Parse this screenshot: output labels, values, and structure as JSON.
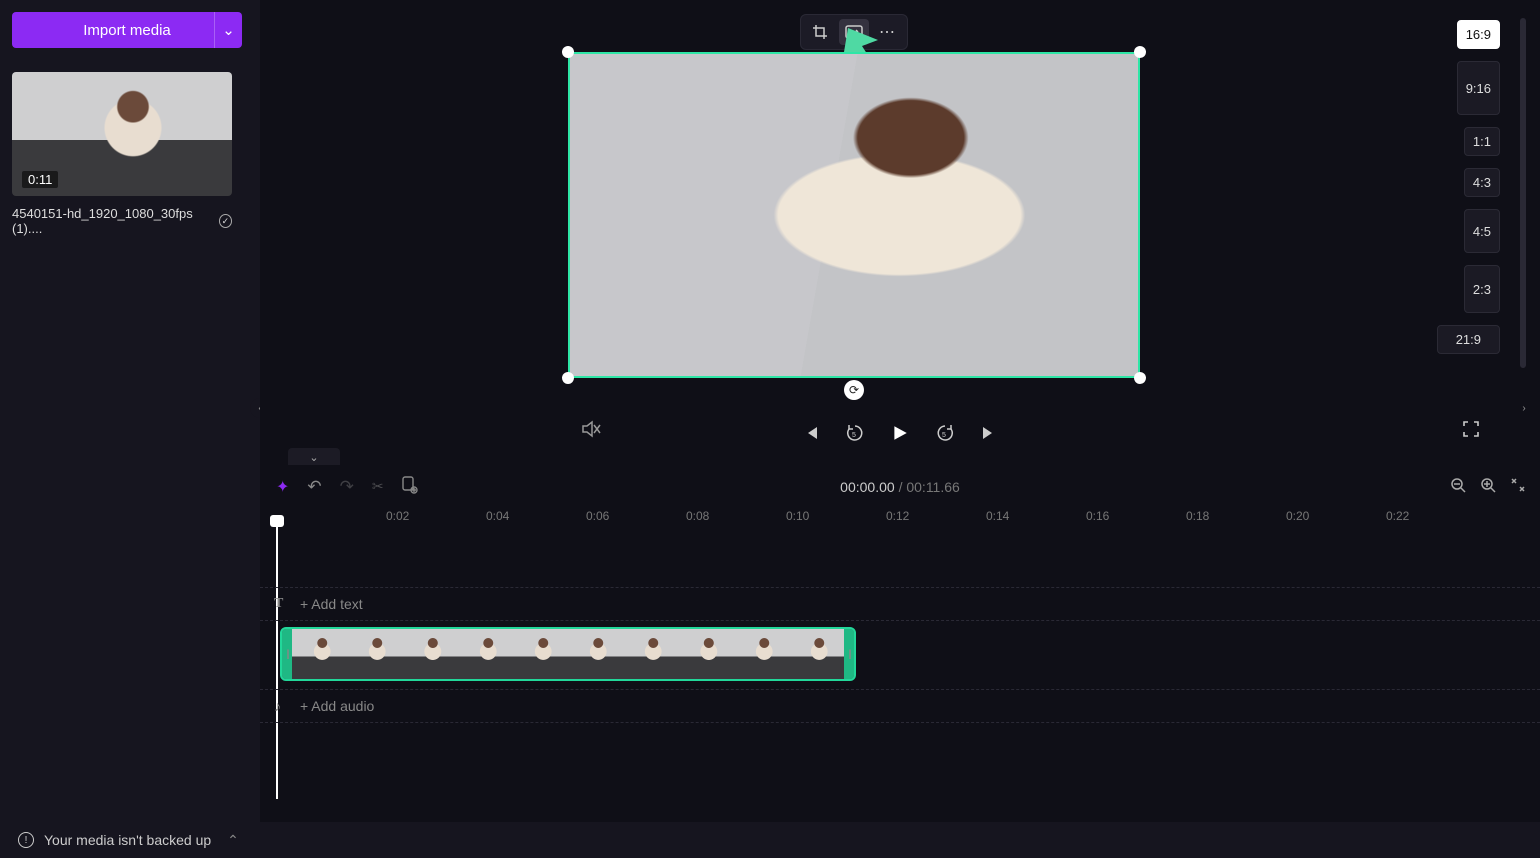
{
  "import_button": {
    "label": "Import media"
  },
  "media_item": {
    "duration": "0:11",
    "name": "4540151-hd_1920_1080_30fps (1)...."
  },
  "aspect_ratios": {
    "selected": "16:9",
    "options": [
      "16:9",
      "9:16",
      "1:1",
      "4:3",
      "4:5",
      "2:3",
      "21:9"
    ]
  },
  "playback": {
    "current": "00:00.00",
    "separator": " / ",
    "total": "00:11.66"
  },
  "ruler_ticks": [
    "0:02",
    "0:04",
    "0:06",
    "0:08",
    "0:10",
    "0:12",
    "0:14",
    "0:16",
    "0:18",
    "0:20",
    "0:22"
  ],
  "tracks": {
    "text_label": "+ Add text",
    "audio_label": "+ Add audio"
  },
  "footer": {
    "message": "Your media isn't backed up"
  },
  "icons": {
    "chevron_down": "⌄",
    "chevron_left": "‹",
    "chevron_right": "›",
    "crop": "crop",
    "fit": "fit",
    "more": "⋯",
    "rotate": "⟳",
    "mute": "mute",
    "fullscreen": "fs",
    "prev": "prev",
    "back5": "-5",
    "play": "play",
    "fwd5": "+5",
    "next": "next",
    "sparkle": "✦",
    "undo": "↶",
    "redo": "↷",
    "cut": "✂",
    "paste": "paste",
    "zoom_out": "−",
    "zoom_in": "+",
    "fit_zoom": "fit",
    "text": "T",
    "audio": "♪",
    "check": "✓",
    "warn": "!"
  }
}
